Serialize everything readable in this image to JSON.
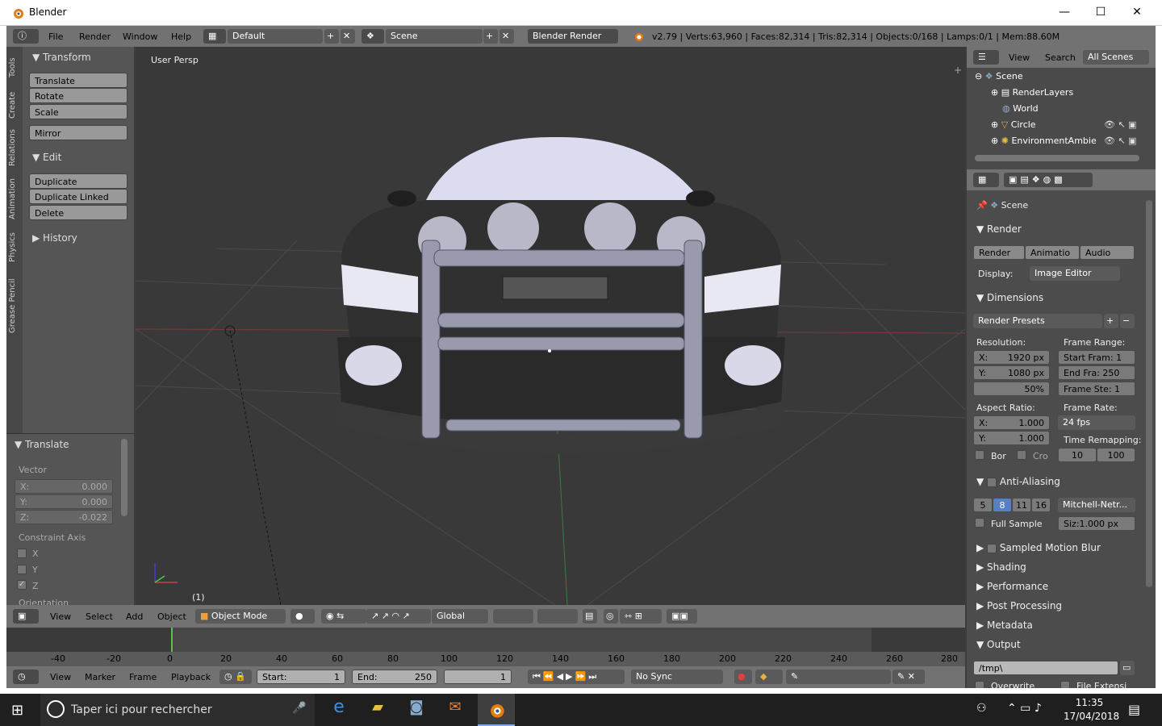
{
  "window": {
    "title": "Blender",
    "min": "—",
    "max": "☐",
    "close": "✕"
  },
  "topbar": {
    "menus": [
      "File",
      "Render",
      "Window",
      "Help"
    ],
    "layout": "Default",
    "scene": "Scene",
    "engine": "Blender Render",
    "stats": "v2.79 | Verts:63,960 | Faces:82,314 | Tris:82,314 | Objects:0/168 | Lamps:0/1 | Mem:88.60M"
  },
  "tabs": [
    "Tools",
    "Create",
    "Relations",
    "Animation",
    "Physics",
    "Grease Pencil"
  ],
  "toolshelf": {
    "transform": "Transform",
    "buttons": [
      "Translate",
      "Rotate",
      "Scale"
    ],
    "mirror": "Mirror",
    "edit": "Edit",
    "edit_buttons": [
      "Duplicate",
      "Duplicate Linked",
      "Delete"
    ],
    "history": "History"
  },
  "operator": {
    "title": "Translate",
    "vector": "Vector",
    "x_label": "X:",
    "x": "0.000",
    "y_label": "Y:",
    "y": "0.000",
    "z_label": "Z:",
    "z": "-0.022",
    "constraint": "Constraint Axis",
    "axes": [
      "X",
      "Y",
      "Z"
    ],
    "orientation": "Orientation"
  },
  "viewport": {
    "label": "User Persp",
    "frame": "(1)"
  },
  "viewheader": {
    "menus": [
      "View",
      "Select",
      "Add",
      "Object"
    ],
    "mode": "Object Mode",
    "orientation": "Global"
  },
  "outliner": {
    "menus": [
      "View",
      "Search"
    ],
    "filter": "All Scenes",
    "items": [
      "Scene",
      "RenderLayers",
      "World",
      "Circle",
      "EnvironmentAmbie"
    ]
  },
  "props": {
    "context": "Scene",
    "render_title": "Render",
    "render_btns": [
      "Render",
      "Animatio",
      "Audio"
    ],
    "display_label": "Display:",
    "display": "Image Editor",
    "dimensions": "Dimensions",
    "presets": "Render Presets",
    "resolution": "Resolution:",
    "res_x_label": "X:",
    "res_x": "1920 px",
    "res_y_label": "Y:",
    "res_y": "1080 px",
    "res_pct": "50%",
    "frame_range": "Frame Range:",
    "start": "Start Fram: 1",
    "end": "End Fra: 250",
    "step": "Frame Ste: 1",
    "aspect": "Aspect Ratio:",
    "asp_x_label": "X:",
    "asp_x": "1.000",
    "asp_y_label": "Y:",
    "asp_y": "1.000",
    "frame_rate": "Frame Rate:",
    "fps": "24 fps",
    "time_remap": "Time Remapping:",
    "remap_old": "10",
    "remap_new": "100",
    "bor": "Bor",
    "cro": "Cro",
    "aa": "Anti-Aliasing",
    "aa_samples": [
      "5",
      "8",
      "11",
      "16"
    ],
    "filter": "Mitchell-Netr...",
    "full_sample": "Full Sample",
    "size": "Siz:1.000 px",
    "motion_blur": "Sampled Motion Blur",
    "sections": [
      "Shading",
      "Performance",
      "Post Processing",
      "Metadata"
    ],
    "output": "Output",
    "output_path": "/tmp\\",
    "overwrite": "Overwrite",
    "file_ext": "File Extensi"
  },
  "timeline": {
    "ticks": [
      "-40",
      "-20",
      "0",
      "20",
      "40",
      "60",
      "80",
      "100",
      "120",
      "140",
      "160",
      "180",
      "200",
      "220",
      "240",
      "260",
      "280"
    ],
    "menus": [
      "View",
      "Marker",
      "Frame",
      "Playback"
    ],
    "start_label": "Start:",
    "start": "1",
    "end_label": "End:",
    "end": "250",
    "current": "1",
    "sync": "No Sync"
  },
  "taskbar": {
    "search": "Taper ici pour rechercher",
    "time": "11:35",
    "date": "17/04/2018"
  },
  "colors": {
    "accent": "#5680c2",
    "header": "#727272",
    "viewport": "#393939"
  }
}
